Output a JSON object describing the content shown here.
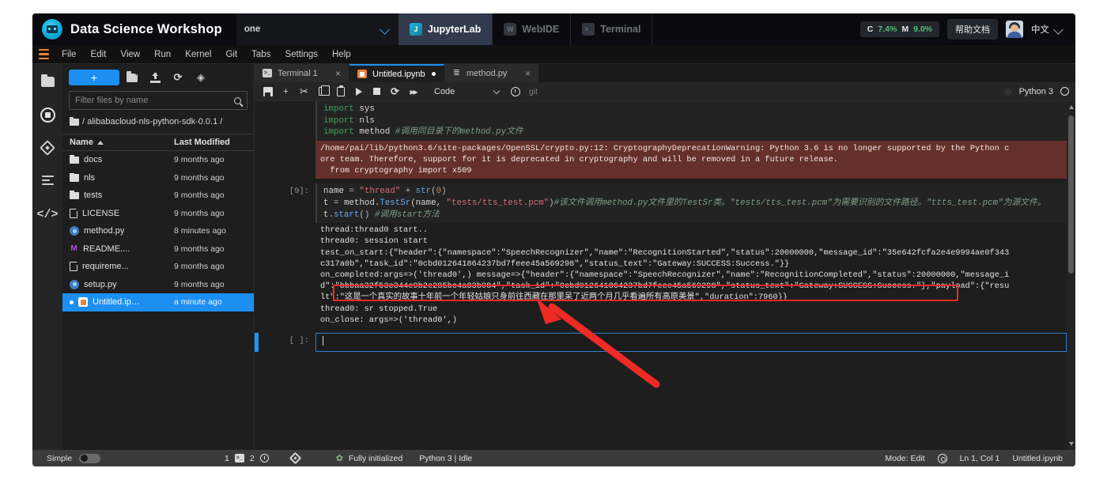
{
  "platform": {
    "title": "Data Science Workshop",
    "workspace": "one",
    "app_tabs": [
      {
        "label": "JupyterLab",
        "active": true
      },
      {
        "label": "WebIDE",
        "active": false
      },
      {
        "label": "Terminal",
        "active": false
      }
    ],
    "resources": {
      "cpu_label": "C",
      "cpu_value": "7.4%",
      "mem_label": "M",
      "mem_value": "9.0%"
    },
    "help_label": "帮助文档",
    "language": "中文"
  },
  "menubar": {
    "items": [
      "File",
      "Edit",
      "View",
      "Run",
      "Kernel",
      "Git",
      "Tabs",
      "Settings",
      "Help"
    ]
  },
  "filebrowser": {
    "new_button": "+",
    "filter_placeholder": "Filter files by name",
    "breadcrumb": "/ alibabacloud-nls-python-sdk-0.0.1 /",
    "columns": {
      "name": "Name",
      "modified": "Last Modified"
    },
    "files": [
      {
        "name": "docs",
        "modified": "9 months ago",
        "icon": "folder",
        "selected": false
      },
      {
        "name": "nls",
        "modified": "9 months ago",
        "icon": "folder",
        "selected": false
      },
      {
        "name": "tests",
        "modified": "9 months ago",
        "icon": "folder",
        "selected": false
      },
      {
        "name": "LICENSE",
        "modified": "9 months ago",
        "icon": "file",
        "selected": false
      },
      {
        "name": "method.py",
        "modified": "8 minutes ago",
        "icon": "python",
        "selected": false
      },
      {
        "name": "README....",
        "modified": "9 months ago",
        "icon": "markdown",
        "selected": false
      },
      {
        "name": "requireme...",
        "modified": "9 months ago",
        "icon": "file",
        "selected": false
      },
      {
        "name": "setup.py",
        "modified": "9 months ago",
        "icon": "python",
        "selected": false
      },
      {
        "name": "Untitled.ip…",
        "modified": "a minute ago",
        "icon": "notebook",
        "selected": true
      }
    ]
  },
  "doc_tabs": [
    {
      "label": "Terminal 1",
      "icon": "terminal",
      "active": false,
      "dirty": false
    },
    {
      "label": "Untitled.ipynb",
      "icon": "notebook",
      "active": true,
      "dirty": true
    },
    {
      "label": "method.py",
      "icon": "python",
      "active": false,
      "dirty": false
    }
  ],
  "notebook_toolbar": {
    "cell_type": "Code",
    "git_label": "git",
    "kernel_name": "Python 3"
  },
  "notebook": {
    "cells": [
      {
        "prompt": "",
        "type": "code",
        "lines": [
          [
            {
              "t": "import",
              "c": "kw"
            },
            {
              "t": " sys",
              "c": "nm"
            }
          ],
          [
            {
              "t": "import",
              "c": "kw"
            },
            {
              "t": " nls",
              "c": "nm"
            }
          ],
          [
            {
              "t": "import",
              "c": "kw"
            },
            {
              "t": " method ",
              "c": "nm"
            },
            {
              "t": "#调用同目录下的method.py文件",
              "c": "cmt"
            }
          ]
        ],
        "outputs": [
          {
            "kind": "warning",
            "text": "/home/pai/lib/python3.6/site-packages/OpenSSL/crypto.py:12: CryptographyDeprecationWarning: Python 3.6 is no longer supported by the Python c\nore team. Therefore, support for it is deprecated in cryptography and will be removed in a future release.\n  from cryptography import x509"
          }
        ]
      },
      {
        "prompt": "[9]:",
        "type": "code",
        "lines": [
          [
            {
              "t": "name ",
              "c": "nm"
            },
            {
              "t": "= ",
              "c": "op"
            },
            {
              "t": "\"thread\"",
              "c": "str"
            },
            {
              "t": " + ",
              "c": "op"
            },
            {
              "t": "str",
              "c": "fn"
            },
            {
              "t": "(",
              "c": "op"
            },
            {
              "t": "0",
              "c": "num"
            },
            {
              "t": ")",
              "c": "op"
            }
          ],
          [
            {
              "t": "t ",
              "c": "nm"
            },
            {
              "t": "= ",
              "c": "op"
            },
            {
              "t": "method.",
              "c": "nm"
            },
            {
              "t": "TestSr",
              "c": "fn"
            },
            {
              "t": "(name, ",
              "c": "nm"
            },
            {
              "t": "\"tests/tts_test.pcm\"",
              "c": "str"
            },
            {
              "t": ")",
              "c": "op"
            },
            {
              "t": "#该文件调用method.py文件里的TestSr类。\"tests/tts_test.pcm\"为需要识别的文件路径。\"ttts_test.pcm\"为源文件。",
              "c": "cmt"
            }
          ],
          [
            {
              "t": "t.",
              "c": "nm"
            },
            {
              "t": "start",
              "c": "fn"
            },
            {
              "t": "()",
              "c": "op"
            },
            {
              "t": " #调用start方法",
              "c": "cmt"
            }
          ]
        ],
        "outputs": [
          {
            "kind": "stdout",
            "text": "thread:thread0 start..\nthread0: session start\ntest_on_start:{\"header\":{\"namespace\":\"SpeechRecognizer\",\"name\":\"RecognitionStarted\",\"status\":20000000,\"message_id\":\"35e642fcfa2e4e9994ae0f343\nc317a0b\",\"task_id\":\"0cbd012641864237bd7feee45a569298\",\"status_text\":\"Gateway:SUCCESS:Success.\"}}\non_completed:args=>('thread0',) message=>{\"header\":{\"namespace\":\"SpeechRecognizer\",\"name\":\"RecognitionCompleted\",\"status\":20000000,\"message_i\nd\":\"bbbaa32f53e344e9b2e285bc4a83b084\",\"task_id\":\"0cbd012641864237bd7feee45a569298\",\"status_text\":\"Gateway:SUCCESS:Success.\"},\"payload\":{\"resu\nlt\":\"这是一个真实的故事十年前一个年轻姑娘只身前往西藏在那里呆了近两个月几乎看遍所有高原美景\",\"duration\":7960}}\nthread0: sr stopped.True\non_close: args=>('thread0',)"
          }
        ]
      },
      {
        "prompt": "[ ]:",
        "type": "code",
        "active": true,
        "lines": [],
        "outputs": []
      }
    ]
  },
  "statusbar": {
    "simple_label": "Simple",
    "terminal_count": "1",
    "kernel_count": "2",
    "init_status": "Fully initialized",
    "kernel_status": "Python 3 | Idle",
    "mode": "Mode: Edit",
    "cursor": "Ln 1, Col 1",
    "filename": "Untitled.ipynb"
  },
  "annotations": {
    "highlight_box": "result value highlighted in red",
    "arrow": "red arrow pointing at recognition result"
  },
  "colors": {
    "accent_blue": "#1d8ff2",
    "annotation_red": "#ee2b24",
    "warning_bg": "#65302c",
    "panel_bg": "#1e1e1e"
  }
}
